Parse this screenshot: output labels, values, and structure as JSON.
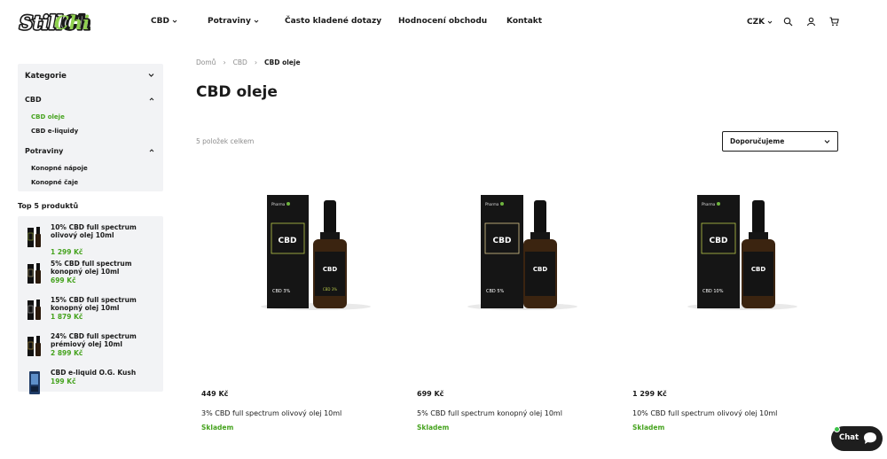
{
  "brand": {
    "logo_text": "StillChill",
    "accent_color": "#46a31f"
  },
  "nav": {
    "items": [
      {
        "label": "CBD",
        "has_dropdown": true
      },
      {
        "label": "Potraviny",
        "has_dropdown": true
      },
      {
        "label": "Často kladené dotazy",
        "has_dropdown": false
      },
      {
        "label": "Hodnocení obchodu",
        "has_dropdown": false
      },
      {
        "label": "Kontakt",
        "has_dropdown": false
      }
    ],
    "currency": "CZK",
    "icons": [
      "search-icon",
      "user-icon",
      "cart-icon"
    ]
  },
  "sidebar": {
    "categories_title": "Kategorie",
    "groups": [
      {
        "title": "CBD",
        "expanded": true,
        "items": [
          {
            "label": "CBD oleje",
            "active": true
          },
          {
            "label": "CBD e-liquidy",
            "active": false
          }
        ]
      },
      {
        "title": "Potraviny",
        "expanded": true,
        "items": [
          {
            "label": "Konopné nápoje",
            "active": false
          },
          {
            "label": "Konopné čaje",
            "active": false
          }
        ]
      }
    ],
    "top5_title": "Top 5 produktů",
    "top5": [
      {
        "name": "10% CBD full spectrum olivový olej 10ml",
        "price": "1 299 Kč"
      },
      {
        "name": "5% CBD full spectrum konopný olej 10ml",
        "price": "699 Kč"
      },
      {
        "name": "15% CBD full spectrum konopný olej 10ml",
        "price": "1 879 Kč"
      },
      {
        "name": "24% CBD full spectrum prémiový olej 10ml",
        "price": "2 899 Kč"
      },
      {
        "name": "CBD e-liquid O.G. Kush",
        "price": "199 Kč"
      }
    ]
  },
  "main": {
    "breadcrumb": [
      "Domů",
      "CBD",
      "CBD oleje"
    ],
    "title": "CBD oleje",
    "count": "5 položek celkem",
    "sort_value": "Doporučujeme"
  },
  "products": [
    {
      "price": "449 Kč",
      "name": "3% CBD full spectrum olivový olej 10ml",
      "stock": "Skladem",
      "box_label": "CBD 3%"
    },
    {
      "price": "699 Kč",
      "name": "5% CBD full spectrum konopný olej 10ml",
      "stock": "Skladem",
      "box_label": "CBD 5%"
    },
    {
      "price": "1 299 Kč",
      "name": "10% CBD full spectrum olivový olej 10ml",
      "stock": "Skladem",
      "box_label": "CBD 10%"
    }
  ],
  "chat": {
    "label": "Chat"
  }
}
